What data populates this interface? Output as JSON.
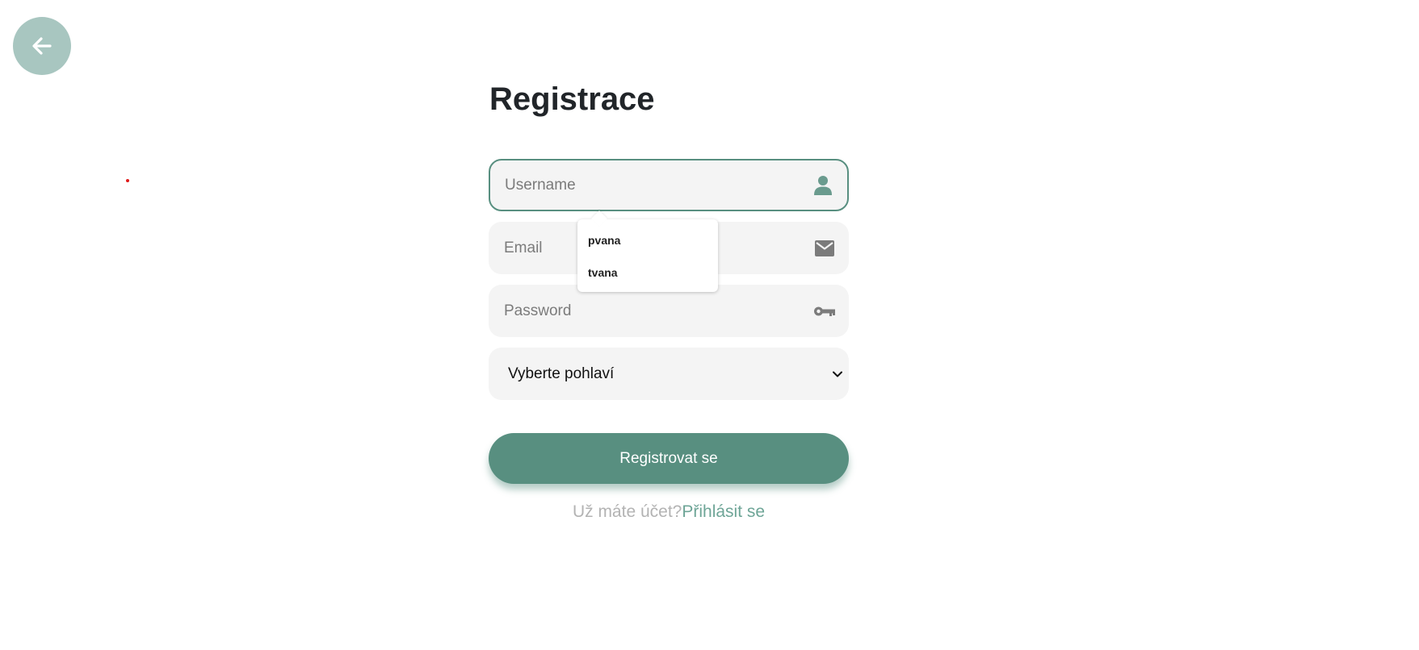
{
  "page": {
    "title": "Registrace",
    "colors": {
      "accent": "#588f80",
      "back_button_bg": "#a8c6c0",
      "field_bg": "#f4f4f4",
      "link": "#6ea597"
    }
  },
  "back_button": {
    "icon": "arrow-left-icon"
  },
  "form": {
    "username": {
      "placeholder": "Username",
      "value": "",
      "icon": "user-icon",
      "focused": true
    },
    "email": {
      "placeholder": "Email",
      "value": "",
      "icon": "envelope-icon"
    },
    "password": {
      "placeholder": "Password",
      "value": "",
      "icon": "key-icon"
    },
    "gender": {
      "selected": "Vyberte pohlaví",
      "icon": "chevron-down-icon"
    },
    "submit_label": "Registrovat se"
  },
  "autocomplete": {
    "options": [
      "pvana",
      "tvana"
    ]
  },
  "footer": {
    "question": "Už máte účet?",
    "login_link": "Přihlásit se"
  }
}
